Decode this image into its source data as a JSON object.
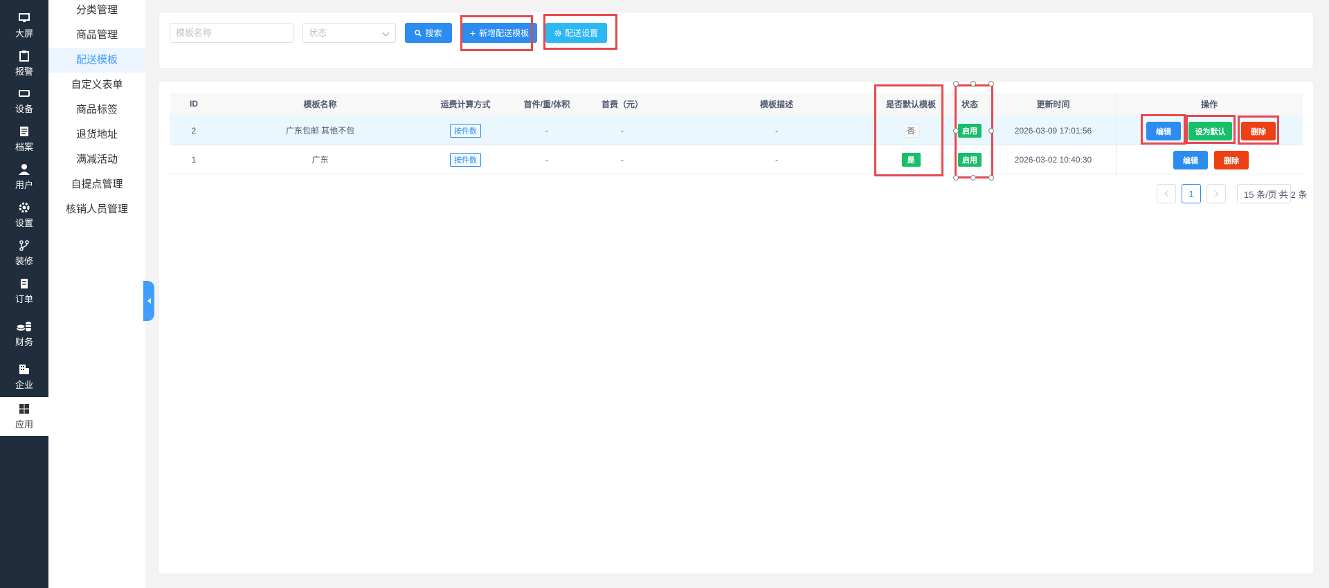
{
  "nav": [
    {
      "label": "大屏",
      "icon": "monitor-icon"
    },
    {
      "label": "报警",
      "icon": "clipboard-icon"
    },
    {
      "label": "设备",
      "icon": "device-icon"
    },
    {
      "label": "档案",
      "icon": "archive-icon"
    },
    {
      "label": "用户",
      "icon": "user-icon"
    },
    {
      "label": "设置",
      "icon": "gear-icon"
    },
    {
      "label": "装修",
      "icon": "branch-icon"
    },
    {
      "label": "订单",
      "icon": "order-icon"
    },
    {
      "label": "财务",
      "icon": "coins-icon"
    },
    {
      "label": "企业",
      "icon": "building-icon"
    },
    {
      "label": "应用",
      "icon": "windows-icon"
    }
  ],
  "submenu": [
    "分类管理",
    "商品管理",
    "配送模板",
    "自定义表单",
    "商品标签",
    "退货地址",
    "满减活动",
    "自提点管理",
    "核销人员管理"
  ],
  "filter": {
    "name_placeholder": "模板名称",
    "status_placeholder": "状态",
    "search_label": "搜索",
    "add_label": "新增配送模板",
    "settings_label": "配送设置"
  },
  "table": {
    "headers": [
      "ID",
      "模板名称",
      "运费计算方式",
      "首件/重/体积",
      "首费（元）",
      "模板描述",
      "是否默认模板",
      "状态",
      "更新时间",
      "操作"
    ],
    "rows": [
      {
        "id": "2",
        "name": "广东包邮 其他不包",
        "calc": "按件数",
        "first": "-",
        "fee": "-",
        "desc": "-",
        "default": "否",
        "status": "启用",
        "updated": "2026-03-09 17:01:56",
        "edit": "编辑",
        "setdefault": "设为默认",
        "delete": "删除"
      },
      {
        "id": "1",
        "name": "广东",
        "calc": "按件数",
        "first": "-",
        "fee": "-",
        "desc": "-",
        "default": "是",
        "status": "启用",
        "updated": "2026-03-02 10:40:30",
        "edit": "编辑",
        "delete": "删除"
      }
    ]
  },
  "pagination": {
    "total_text": "共 2 条",
    "current": "1",
    "page_size": "15 条/页"
  }
}
